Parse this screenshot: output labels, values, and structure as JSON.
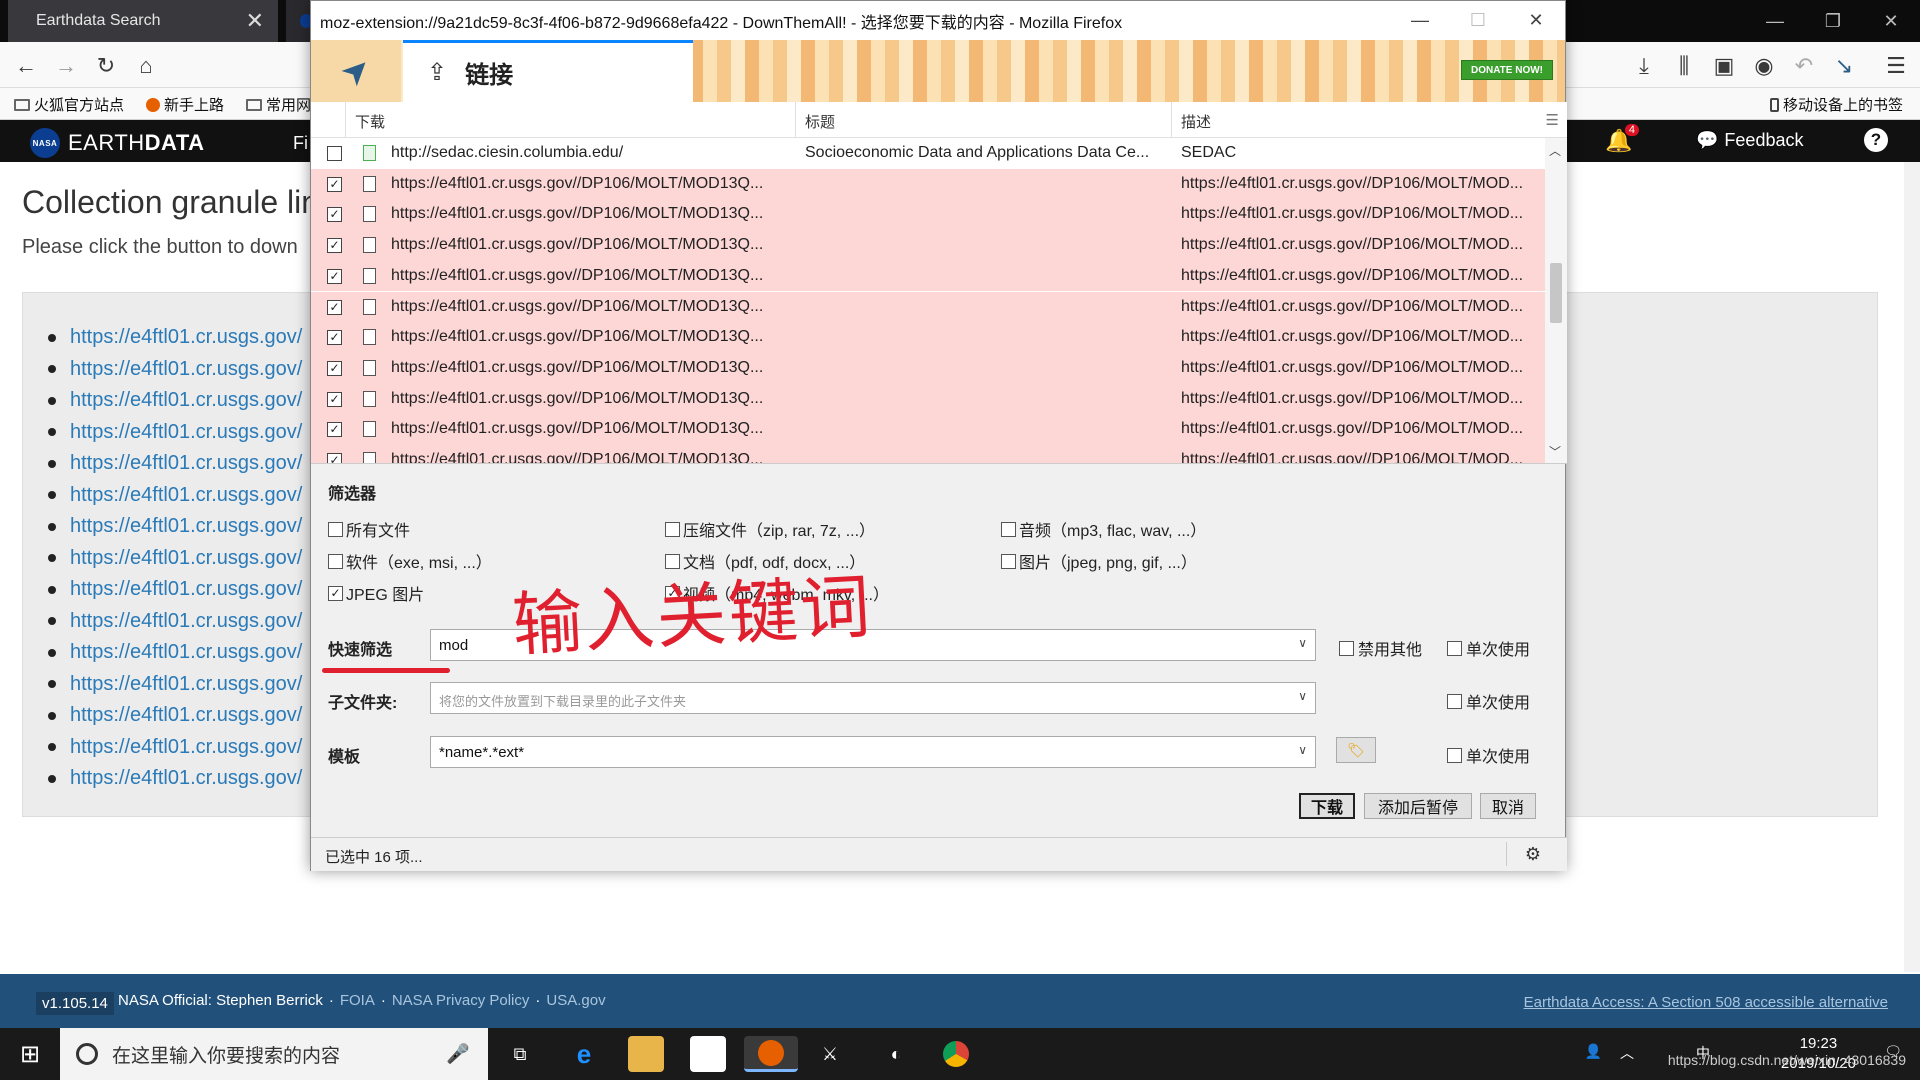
{
  "browser": {
    "tabs": [
      {
        "title": "Earthdata Search",
        "close": "✕"
      },
      {
        "title": ""
      }
    ],
    "window_controls": [
      "—",
      "❐",
      "✕"
    ],
    "bookmarks": [
      "火狐官方站点",
      "新手上路",
      "常用网",
      "移动设备上的书签"
    ]
  },
  "earthdata": {
    "logo_a": "EARTH",
    "logo_b": "DATA",
    "nasa_badge": "NASA",
    "nav_partial": "Fi",
    "notification_count": "4",
    "feedback": "Feedback",
    "help": "?",
    "title": "Collection granule lin",
    "subtitle": "Please click the button to down",
    "links": [
      "https://e4ftl01.cr.usgs.gov/",
      "https://e4ftl01.cr.usgs.gov/",
      "https://e4ftl01.cr.usgs.gov/",
      "https://e4ftl01.cr.usgs.gov/",
      "https://e4ftl01.cr.usgs.gov/",
      "https://e4ftl01.cr.usgs.gov/",
      "https://e4ftl01.cr.usgs.gov/",
      "https://e4ftl01.cr.usgs.gov/",
      "https://e4ftl01.cr.usgs.gov/",
      "https://e4ftl01.cr.usgs.gov/",
      "https://e4ftl01.cr.usgs.gov/",
      "https://e4ftl01.cr.usgs.gov/",
      "https://e4ftl01.cr.usgs.gov/",
      "https://e4ftl01.cr.usgs.gov/",
      "https://e4ftl01.cr.usgs.gov/"
    ],
    "footer": {
      "version": "v1.105.14",
      "official": "NASA Official: Stephen Berrick",
      "links": [
        "FOIA",
        "NASA Privacy Policy",
        "USA.gov"
      ],
      "accessibility": "Earthdata Access: A Section 508 accessible alternative"
    }
  },
  "dialog": {
    "title": "moz-extension://9a21dc59-8c3f-4f06-b872-9d9668efa422 - DownThemAll! - 选择您要下载的内容 - Mozilla Firefox",
    "tab_label": "链接",
    "donate_label": "DONATE NOW!",
    "columns": [
      "下载",
      "标题",
      "描述"
    ],
    "rows": [
      {
        "checked": false,
        "url": "http://sedac.ciesin.columbia.edu/",
        "title": "Socioeconomic Data and Applications Data Ce...",
        "desc": "SEDAC"
      },
      {
        "checked": true,
        "url": "https://e4ftl01.cr.usgs.gov//DP106/MOLT/MOD13Q...",
        "title": "",
        "desc": "https://e4ftl01.cr.usgs.gov//DP106/MOLT/MOD..."
      },
      {
        "checked": true,
        "url": "https://e4ftl01.cr.usgs.gov//DP106/MOLT/MOD13Q...",
        "title": "",
        "desc": "https://e4ftl01.cr.usgs.gov//DP106/MOLT/MOD..."
      },
      {
        "checked": true,
        "url": "https://e4ftl01.cr.usgs.gov//DP106/MOLT/MOD13Q...",
        "title": "",
        "desc": "https://e4ftl01.cr.usgs.gov//DP106/MOLT/MOD..."
      },
      {
        "checked": true,
        "url": "https://e4ftl01.cr.usgs.gov//DP106/MOLT/MOD13Q...",
        "title": "",
        "desc": "https://e4ftl01.cr.usgs.gov//DP106/MOLT/MOD..."
      },
      {
        "checked": true,
        "url": "https://e4ftl01.cr.usgs.gov//DP106/MOLT/MOD13Q...",
        "title": "",
        "desc": "https://e4ftl01.cr.usgs.gov//DP106/MOLT/MOD..."
      },
      {
        "checked": true,
        "url": "https://e4ftl01.cr.usgs.gov//DP106/MOLT/MOD13Q...",
        "title": "",
        "desc": "https://e4ftl01.cr.usgs.gov//DP106/MOLT/MOD..."
      },
      {
        "checked": true,
        "url": "https://e4ftl01.cr.usgs.gov//DP106/MOLT/MOD13Q...",
        "title": "",
        "desc": "https://e4ftl01.cr.usgs.gov//DP106/MOLT/MOD..."
      },
      {
        "checked": true,
        "url": "https://e4ftl01.cr.usgs.gov//DP106/MOLT/MOD13Q...",
        "title": "",
        "desc": "https://e4ftl01.cr.usgs.gov//DP106/MOLT/MOD..."
      },
      {
        "checked": true,
        "url": "https://e4ftl01.cr.usgs.gov//DP106/MOLT/MOD13Q...",
        "title": "",
        "desc": "https://e4ftl01.cr.usgs.gov//DP106/MOLT/MOD..."
      },
      {
        "checked": true,
        "url": "https://e4ftl01.cr.usgs.gov//DP106/MOLT/MOD13Q...",
        "title": "",
        "desc": "https://e4ftl01.cr.usgs.gov//DP106/MOLT/MOD..."
      }
    ],
    "filters_label": "筛选器",
    "filters": [
      {
        "label": "所有文件",
        "checked": false
      },
      {
        "label": "压缩文件（zip, rar, 7z, ...）",
        "checked": false
      },
      {
        "label": "音频（mp3, flac, wav, ...）",
        "checked": false
      },
      {
        "label": "软件（exe, msi, ...）",
        "checked": false
      },
      {
        "label": "文档（pdf, odf, docx, ...）",
        "checked": false
      },
      {
        "label": "图片（jpeg, png, gif, ...）",
        "checked": false
      },
      {
        "label": "JPEG 图片",
        "checked": true
      },
      {
        "label": "视频（mp4, webm, mkv, ...）",
        "checked": true
      }
    ],
    "quick_filter": {
      "label": "快速筛选",
      "value": "mod",
      "disable_others": "禁用其他",
      "once": "单次使用"
    },
    "subfolder": {
      "label": "子文件夹:",
      "placeholder": "将您的文件放置到下载目录里的此子文件夹",
      "once": "单次使用"
    },
    "template": {
      "label": "模板",
      "value": "*name*.*ext*",
      "once": "单次使用"
    },
    "buttons": {
      "download": "下载",
      "add_paused": "添加后暂停",
      "cancel": "取消"
    },
    "status": "已选中 16 项..."
  },
  "annotation": "输入关键词",
  "taskbar": {
    "search_placeholder": "在这里输入你要搜索的内容",
    "time": "19:23",
    "date": "2019/10/20",
    "ime": "中",
    "watermark": "https://blog.csdn.net/weixin_43016839"
  }
}
